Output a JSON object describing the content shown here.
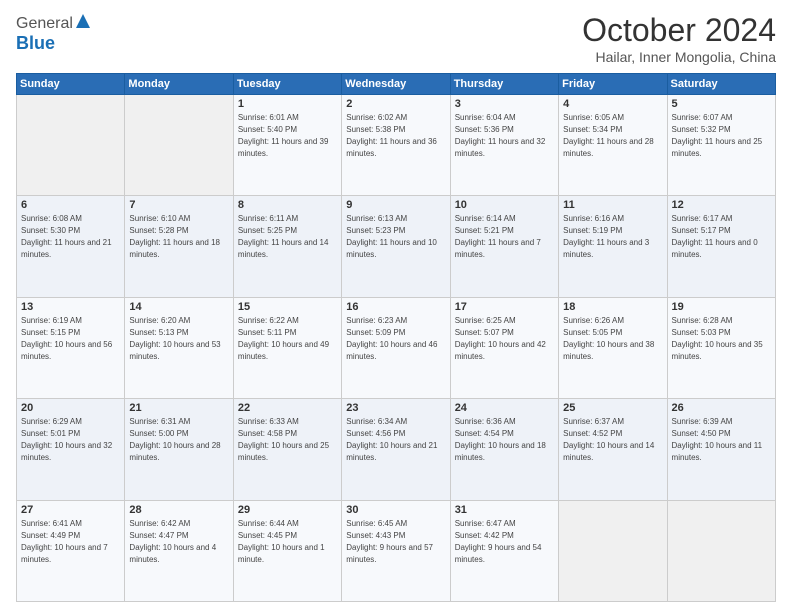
{
  "header": {
    "logo_general": "General",
    "logo_blue": "Blue",
    "title": "October 2024",
    "location": "Hailar, Inner Mongolia, China"
  },
  "days_of_week": [
    "Sunday",
    "Monday",
    "Tuesday",
    "Wednesday",
    "Thursday",
    "Friday",
    "Saturday"
  ],
  "weeks": [
    [
      {
        "day": "",
        "sunrise": "",
        "sunset": "",
        "daylight": ""
      },
      {
        "day": "",
        "sunrise": "",
        "sunset": "",
        "daylight": ""
      },
      {
        "day": "1",
        "sunrise": "Sunrise: 6:01 AM",
        "sunset": "Sunset: 5:40 PM",
        "daylight": "Daylight: 11 hours and 39 minutes."
      },
      {
        "day": "2",
        "sunrise": "Sunrise: 6:02 AM",
        "sunset": "Sunset: 5:38 PM",
        "daylight": "Daylight: 11 hours and 36 minutes."
      },
      {
        "day": "3",
        "sunrise": "Sunrise: 6:04 AM",
        "sunset": "Sunset: 5:36 PM",
        "daylight": "Daylight: 11 hours and 32 minutes."
      },
      {
        "day": "4",
        "sunrise": "Sunrise: 6:05 AM",
        "sunset": "Sunset: 5:34 PM",
        "daylight": "Daylight: 11 hours and 28 minutes."
      },
      {
        "day": "5",
        "sunrise": "Sunrise: 6:07 AM",
        "sunset": "Sunset: 5:32 PM",
        "daylight": "Daylight: 11 hours and 25 minutes."
      }
    ],
    [
      {
        "day": "6",
        "sunrise": "Sunrise: 6:08 AM",
        "sunset": "Sunset: 5:30 PM",
        "daylight": "Daylight: 11 hours and 21 minutes."
      },
      {
        "day": "7",
        "sunrise": "Sunrise: 6:10 AM",
        "sunset": "Sunset: 5:28 PM",
        "daylight": "Daylight: 11 hours and 18 minutes."
      },
      {
        "day": "8",
        "sunrise": "Sunrise: 6:11 AM",
        "sunset": "Sunset: 5:25 PM",
        "daylight": "Daylight: 11 hours and 14 minutes."
      },
      {
        "day": "9",
        "sunrise": "Sunrise: 6:13 AM",
        "sunset": "Sunset: 5:23 PM",
        "daylight": "Daylight: 11 hours and 10 minutes."
      },
      {
        "day": "10",
        "sunrise": "Sunrise: 6:14 AM",
        "sunset": "Sunset: 5:21 PM",
        "daylight": "Daylight: 11 hours and 7 minutes."
      },
      {
        "day": "11",
        "sunrise": "Sunrise: 6:16 AM",
        "sunset": "Sunset: 5:19 PM",
        "daylight": "Daylight: 11 hours and 3 minutes."
      },
      {
        "day": "12",
        "sunrise": "Sunrise: 6:17 AM",
        "sunset": "Sunset: 5:17 PM",
        "daylight": "Daylight: 11 hours and 0 minutes."
      }
    ],
    [
      {
        "day": "13",
        "sunrise": "Sunrise: 6:19 AM",
        "sunset": "Sunset: 5:15 PM",
        "daylight": "Daylight: 10 hours and 56 minutes."
      },
      {
        "day": "14",
        "sunrise": "Sunrise: 6:20 AM",
        "sunset": "Sunset: 5:13 PM",
        "daylight": "Daylight: 10 hours and 53 minutes."
      },
      {
        "day": "15",
        "sunrise": "Sunrise: 6:22 AM",
        "sunset": "Sunset: 5:11 PM",
        "daylight": "Daylight: 10 hours and 49 minutes."
      },
      {
        "day": "16",
        "sunrise": "Sunrise: 6:23 AM",
        "sunset": "Sunset: 5:09 PM",
        "daylight": "Daylight: 10 hours and 46 minutes."
      },
      {
        "day": "17",
        "sunrise": "Sunrise: 6:25 AM",
        "sunset": "Sunset: 5:07 PM",
        "daylight": "Daylight: 10 hours and 42 minutes."
      },
      {
        "day": "18",
        "sunrise": "Sunrise: 6:26 AM",
        "sunset": "Sunset: 5:05 PM",
        "daylight": "Daylight: 10 hours and 38 minutes."
      },
      {
        "day": "19",
        "sunrise": "Sunrise: 6:28 AM",
        "sunset": "Sunset: 5:03 PM",
        "daylight": "Daylight: 10 hours and 35 minutes."
      }
    ],
    [
      {
        "day": "20",
        "sunrise": "Sunrise: 6:29 AM",
        "sunset": "Sunset: 5:01 PM",
        "daylight": "Daylight: 10 hours and 32 minutes."
      },
      {
        "day": "21",
        "sunrise": "Sunrise: 6:31 AM",
        "sunset": "Sunset: 5:00 PM",
        "daylight": "Daylight: 10 hours and 28 minutes."
      },
      {
        "day": "22",
        "sunrise": "Sunrise: 6:33 AM",
        "sunset": "Sunset: 4:58 PM",
        "daylight": "Daylight: 10 hours and 25 minutes."
      },
      {
        "day": "23",
        "sunrise": "Sunrise: 6:34 AM",
        "sunset": "Sunset: 4:56 PM",
        "daylight": "Daylight: 10 hours and 21 minutes."
      },
      {
        "day": "24",
        "sunrise": "Sunrise: 6:36 AM",
        "sunset": "Sunset: 4:54 PM",
        "daylight": "Daylight: 10 hours and 18 minutes."
      },
      {
        "day": "25",
        "sunrise": "Sunrise: 6:37 AM",
        "sunset": "Sunset: 4:52 PM",
        "daylight": "Daylight: 10 hours and 14 minutes."
      },
      {
        "day": "26",
        "sunrise": "Sunrise: 6:39 AM",
        "sunset": "Sunset: 4:50 PM",
        "daylight": "Daylight: 10 hours and 11 minutes."
      }
    ],
    [
      {
        "day": "27",
        "sunrise": "Sunrise: 6:41 AM",
        "sunset": "Sunset: 4:49 PM",
        "daylight": "Daylight: 10 hours and 7 minutes."
      },
      {
        "day": "28",
        "sunrise": "Sunrise: 6:42 AM",
        "sunset": "Sunset: 4:47 PM",
        "daylight": "Daylight: 10 hours and 4 minutes."
      },
      {
        "day": "29",
        "sunrise": "Sunrise: 6:44 AM",
        "sunset": "Sunset: 4:45 PM",
        "daylight": "Daylight: 10 hours and 1 minute."
      },
      {
        "day": "30",
        "sunrise": "Sunrise: 6:45 AM",
        "sunset": "Sunset: 4:43 PM",
        "daylight": "Daylight: 9 hours and 57 minutes."
      },
      {
        "day": "31",
        "sunrise": "Sunrise: 6:47 AM",
        "sunset": "Sunset: 4:42 PM",
        "daylight": "Daylight: 9 hours and 54 minutes."
      },
      {
        "day": "",
        "sunrise": "",
        "sunset": "",
        "daylight": ""
      },
      {
        "day": "",
        "sunrise": "",
        "sunset": "",
        "daylight": ""
      }
    ]
  ]
}
